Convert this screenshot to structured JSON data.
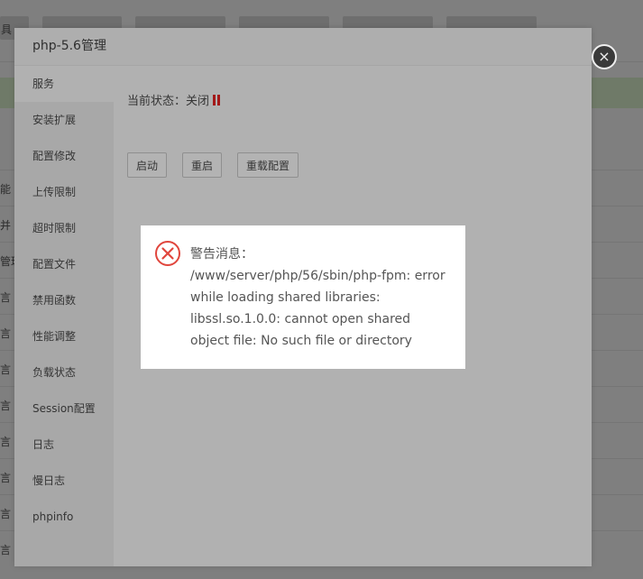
{
  "background": {
    "tab_fragment": "具",
    "row_fragments": [
      "能",
      "并",
      "管理",
      "言",
      "言",
      "言",
      "言",
      "言",
      "言",
      "言",
      "言"
    ]
  },
  "dialog": {
    "title": "php-5.6管理",
    "close_symbol": "×",
    "sidebar": {
      "items": [
        {
          "label": "服务",
          "active": true
        },
        {
          "label": "安装扩展"
        },
        {
          "label": "配置修改"
        },
        {
          "label": "上传限制"
        },
        {
          "label": "超时限制"
        },
        {
          "label": "配置文件"
        },
        {
          "label": "禁用函数"
        },
        {
          "label": "性能调整"
        },
        {
          "label": "负载状态"
        },
        {
          "label": "Session配置"
        },
        {
          "label": "日志"
        },
        {
          "label": "慢日志"
        },
        {
          "label": "phpinfo"
        }
      ]
    },
    "content": {
      "status_label": "当前状态：",
      "status_value": "关闭",
      "status_icon": "pause-icon",
      "status_color": "#a31919",
      "buttons": {
        "start": "启动",
        "restart": "重启",
        "reload": "重载配置"
      }
    }
  },
  "alert": {
    "icon": "error-circle-icon",
    "icon_color": "#e0463d",
    "title": "警告消息：",
    "message": "/www/server/php/56/sbin/php-fpm: error while loading shared libraries: libssl.so.1.0.0: cannot open shared object file: No such file or directory"
  }
}
